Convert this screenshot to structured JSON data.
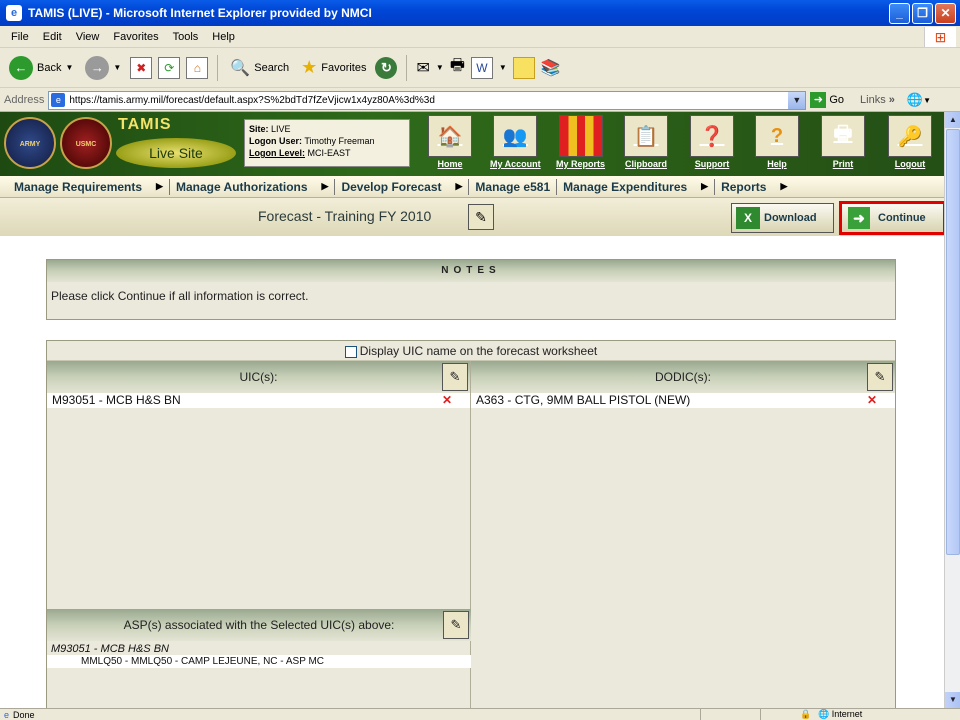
{
  "window": {
    "title": "TAMIS (LIVE) - Microsoft Internet Explorer provided by NMCI"
  },
  "menubar": [
    "File",
    "Edit",
    "View",
    "Favorites",
    "Tools",
    "Help"
  ],
  "toolbar": {
    "back": "Back",
    "search": "Search",
    "favorites": "Favorites"
  },
  "address": {
    "label": "Address",
    "url": "https://tamis.army.mil/forecast/default.aspx?S%2bdTd7fZeVjicw1x4yz80A%3d%3d",
    "go": "Go",
    "links": "Links"
  },
  "header": {
    "app_name": "TAMIS",
    "live_site": "Live Site",
    "seal_army": "ARMY",
    "seal_usmc": "USMC",
    "site_label": "Site:",
    "site_value": "LIVE",
    "user_label": "Logon User:",
    "user_value": "Timothy Freeman",
    "level_label": "Logon Level:",
    "level_value": "MCI-EAST",
    "nav": [
      {
        "label": "Home",
        "icon": "🏠"
      },
      {
        "label": "My Account",
        "icon": "👥"
      },
      {
        "label": "My Reports",
        "icon": "▥"
      },
      {
        "label": "Clipboard",
        "icon": "📋"
      },
      {
        "label": "Support",
        "icon": "❓"
      },
      {
        "label": "Help",
        "icon": "?"
      },
      {
        "label": "Print",
        "icon": "🖶"
      },
      {
        "label": "Logout",
        "icon": "🔑"
      }
    ]
  },
  "menu": [
    "Manage Requirements",
    "Manage Authorizations",
    "Develop Forecast",
    "Manage e581",
    "Manage Expenditures",
    "Reports"
  ],
  "page": {
    "title": "Forecast - Training FY 2010",
    "download": "Download",
    "continue": "Continue"
  },
  "notes": {
    "heading": "NOTES",
    "text": "Please click Continue if all information is correct."
  },
  "worksheet": {
    "checkbox_label": "Display UIC name on the forecast worksheet",
    "uic_header": "UIC(s):",
    "dodic_header": "DODIC(s):",
    "uic_rows": [
      "M93051 - MCB H&S BN"
    ],
    "dodic_rows": [
      "A363 - CTG, 9MM BALL PISTOL (NEW)"
    ],
    "asp_header": "ASP(s) associated with the Selected UIC(s) above:",
    "asp_uic": "M93051 - MCB H&S BN",
    "asp_rows": [
      "MMLQ50 - MMLQ50 - CAMP LEJEUNE, NC - ASP MC"
    ]
  },
  "status": {
    "text": "Done",
    "zone": "Internet"
  }
}
